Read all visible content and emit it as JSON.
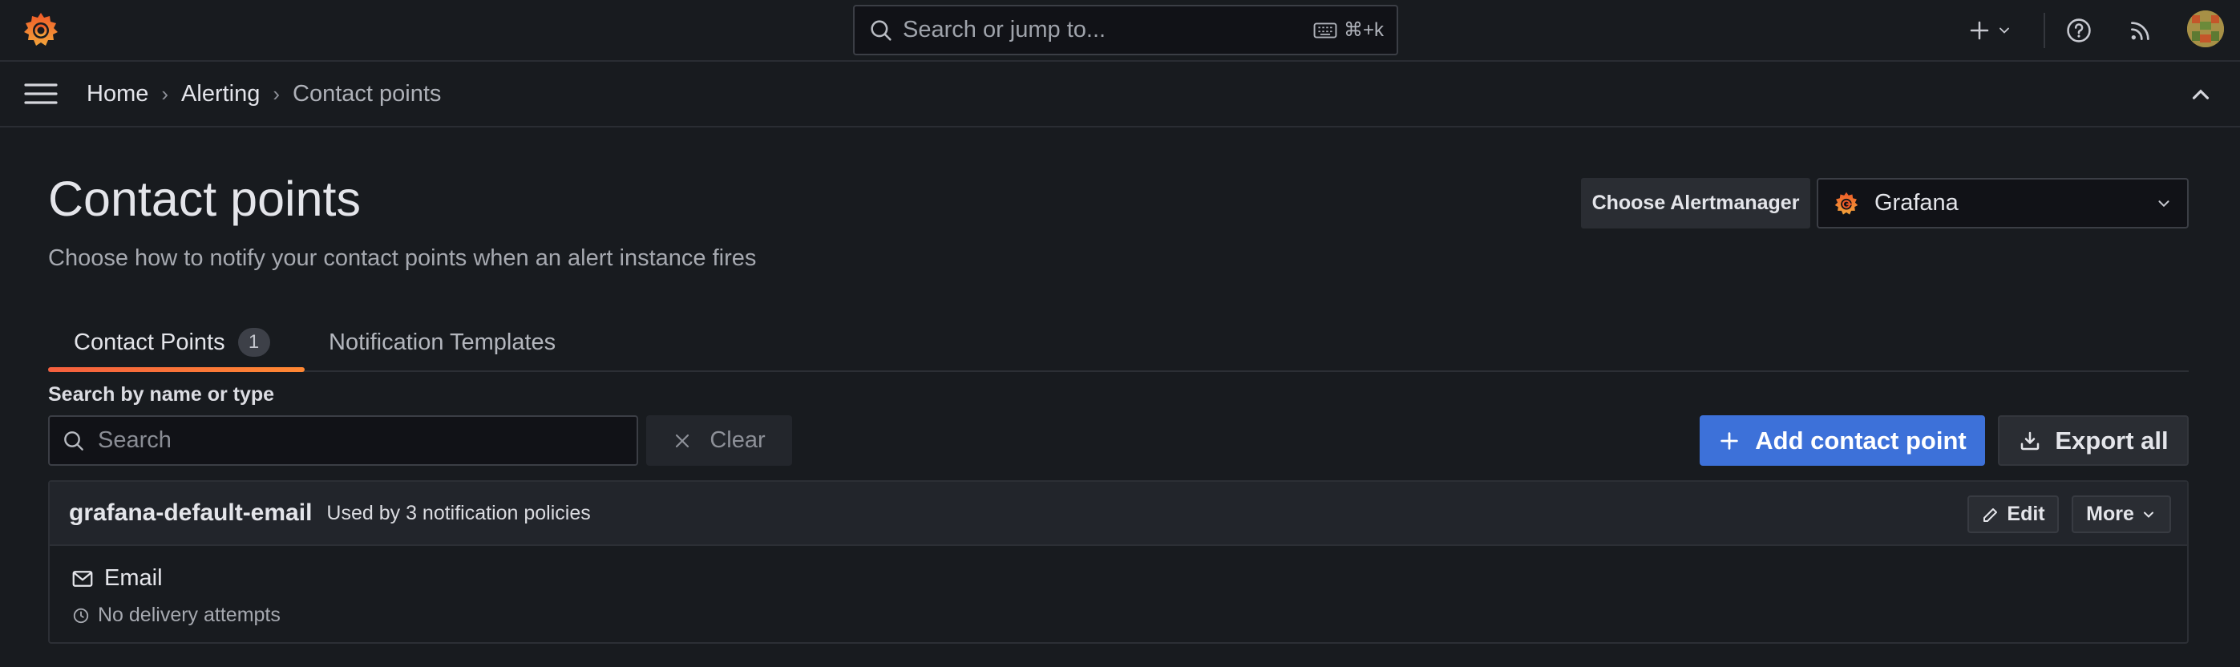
{
  "topbar": {
    "search_placeholder": "Search or jump to...",
    "search_shortcut": "⌘+k",
    "logo_icon": "grafana-logo-icon",
    "add_icon": "plus-icon",
    "help_icon": "help-circle-icon",
    "news_icon": "rss-icon",
    "avatar_icon": "user-avatar"
  },
  "breadcrumb": {
    "items": [
      "Home",
      "Alerting",
      "Contact points"
    ]
  },
  "page": {
    "title": "Contact points",
    "subtitle": "Choose how to notify your contact points when an alert instance fires"
  },
  "alertmanager": {
    "label": "Choose Alertmanager",
    "selected": "Grafana"
  },
  "tabs": [
    {
      "label": "Contact Points",
      "count": "1",
      "active": true
    },
    {
      "label": "Notification Templates",
      "active": false
    }
  ],
  "search": {
    "label": "Search by name or type",
    "placeholder": "Search",
    "value": "",
    "clear_label": "Clear"
  },
  "actions": {
    "add_label": "Add contact point",
    "export_label": "Export all"
  },
  "contact_points": [
    {
      "name": "grafana-default-email",
      "usage": "Used by 3 notification policies",
      "edit_label": "Edit",
      "more_label": "More",
      "integrations": [
        {
          "name": "Email",
          "icon": "envelope-icon",
          "status": "No delivery attempts"
        }
      ]
    }
  ],
  "colors": {
    "background": "#181b1f",
    "primary": "#3d71d9",
    "tab_accent": "#f55f3e"
  }
}
